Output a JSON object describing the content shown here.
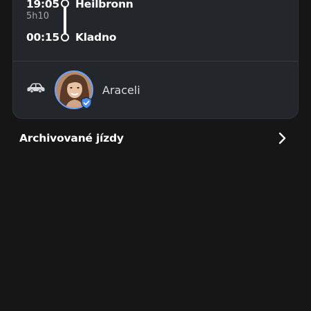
{
  "trip": {
    "departure_time": "19:05",
    "duration": "5h10",
    "arrival_time": "00:15",
    "origin": "Heilbronn",
    "destination": "Kladno"
  },
  "driver": {
    "name": "Araceli",
    "vehicle_icon": "car-icon",
    "verified_icon": "shield-check-icon"
  },
  "archive": {
    "label": "Archivované jízdy",
    "icon": "chevron-right-icon"
  },
  "colors": {
    "background": "#161616",
    "card": "#23272c",
    "accent": "#6aa2ff",
    "text": "#ffffff",
    "muted": "#a4a8ad"
  }
}
